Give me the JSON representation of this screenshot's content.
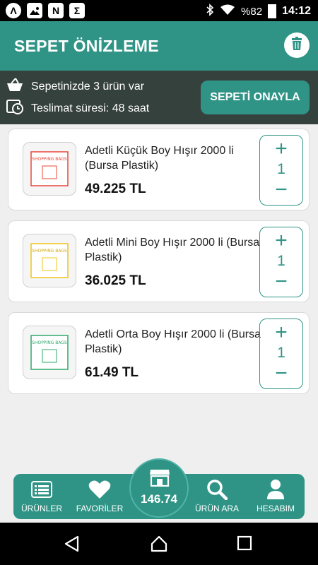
{
  "status_bar": {
    "battery": "%82",
    "time": "14:12"
  },
  "header": {
    "title": "SEPET ÖNİZLEME"
  },
  "info": {
    "items_text": "Sepetinizde 3 ürün var",
    "delivery_text": "Teslimat süresi: 48 saat",
    "confirm_label": "SEPETİ ONAYLA"
  },
  "cart_items": [
    {
      "name": "Adetli Küçük Boy Hışır 2000 li (Bursa Plastik)",
      "price": "49.225 TL",
      "qty": "1",
      "color": "#e8483b"
    },
    {
      "name": "Adetli Mini Boy Hışır 2000 li (Bursa Plastik)",
      "price": "36.025 TL",
      "qty": "1",
      "color": "#f0c419"
    },
    {
      "name": "Adetli Orta Boy Hışır 2000 li (Bursa Plastik)",
      "price": "61.49 TL",
      "qty": "1",
      "color": "#2ea86b"
    }
  ],
  "bottom_nav": {
    "items": [
      {
        "label": "ÜRÜNLER",
        "icon": "list-icon"
      },
      {
        "label": "FAVORİLER",
        "icon": "heart-icon"
      },
      {
        "label": "ÜRÜN ARA",
        "icon": "search-icon"
      },
      {
        "label": "HESABIM",
        "icon": "user-icon"
      }
    ],
    "cart_total": "146.74"
  },
  "colors": {
    "primary": "#2f9486",
    "info_bar": "#35413c"
  }
}
